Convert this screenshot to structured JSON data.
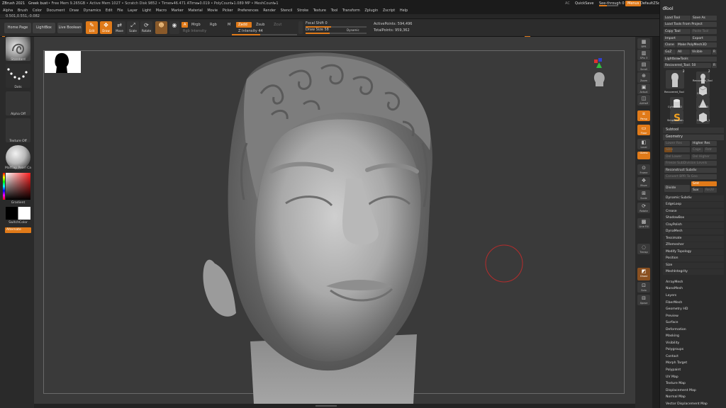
{
  "titlebar": {
    "app": "ZBrush 2021",
    "file": "Greek bust",
    "stats": "• Free Mem 9.265GB • Active Mem 1027 • Scratch Disk 9852 • Timer▸46.471 ATime▸0.019 • PolyCount▸1.089 MP • MeshCount▸1",
    "ai": "AC",
    "quicksave": "QuickSave",
    "see_through": "See-through  0",
    "menus": "Menus",
    "default_script": "DefaultZScript"
  },
  "menu": [
    "Alpha",
    "Brush",
    "Color",
    "Document",
    "Draw",
    "Dynamics",
    "Edit",
    "File",
    "Layer",
    "Light",
    "Macro",
    "Marker",
    "Material",
    "Movie",
    "Picker",
    "Preferences",
    "Render",
    "Stencil",
    "Stroke",
    "Texture",
    "Tool",
    "Transform",
    "Zplugin",
    "Zscript",
    "Help"
  ],
  "coords": "0.501,0.551,-0.082",
  "toolbar": {
    "home_page": "Home Page",
    "lightbox": "LightBox",
    "live_boolean": "Live Boolean",
    "edit": "Edit",
    "draw": "Draw",
    "move": "Move",
    "scale": "Scale",
    "rotate": "Rotate",
    "a_label": "A",
    "mrgb": "Mrgb",
    "rgb": "Rgb",
    "m": "M",
    "zadd": "Zadd",
    "zsub": "Zsub",
    "zcut": "Zcut",
    "rgb_intensity": "Rgb Intensity",
    "z_intensity": "Z Intensity 44",
    "focal_shift": "Focal Shift 0",
    "draw_size": "Draw Size 58",
    "dynamic": "Dynamic",
    "active_points": "ActivePoints: 594,496",
    "total_points": "TotalPoints: 959,362"
  },
  "left_shelf": {
    "brush": "Standard",
    "stroke": "Dots",
    "alpha": "Alpha Off",
    "texture": "Texture Off",
    "material": "MatCap Pearl Ca",
    "gradient": "Gradient",
    "switch_color": "SwitchColor",
    "alternate": "Alternate"
  },
  "right_shelf": [
    {
      "glyph": "▦",
      "label": "BPR"
    },
    {
      "glyph": "▥",
      "label": "SPix 3"
    },
    {
      "glyph": "▤",
      "label": "Scroll"
    },
    {
      "glyph": "⊕",
      "label": "Zoom"
    },
    {
      "glyph": "▣",
      "label": "Actual"
    },
    {
      "glyph": "◫",
      "label": "AAHalf"
    },
    {
      "glyph": "⌗",
      "label": "Persp"
    },
    {
      "glyph": "▭",
      "label": "Floor"
    },
    {
      "glyph": "◧",
      "label": "Local"
    },
    {
      "glyph": "⌖",
      "label": "Gizmo"
    },
    {
      "glyph": "⊙",
      "label": "Frame"
    },
    {
      "glyph": "✥",
      "label": "Move"
    },
    {
      "glyph": "⊞",
      "label": "Scale"
    },
    {
      "glyph": "⟳",
      "label": "Rotate"
    },
    {
      "glyph": "▩",
      "label": "Line Fill"
    },
    {
      "glyph": "◌",
      "label": "Transp"
    },
    {
      "glyph": "◩",
      "label": "Ghost"
    },
    {
      "glyph": "⊡",
      "label": "Solo"
    },
    {
      "glyph": "⊟",
      "label": "Xpose"
    }
  ],
  "tool": {
    "title": "Tool",
    "load_tool": "Load Tool",
    "save_as": "Save As",
    "load_from_project": "Load Tools From Project",
    "copy_tool": "Copy Tool",
    "paste_tool": "Paste Tool",
    "import": "Import",
    "export": "Export",
    "clone": "Clone",
    "make_polymesh": "Make PolyMesh3D",
    "goz": "GoZ",
    "all": "All",
    "visible": "Visible",
    "visible_num": "R",
    "lightbox_tools": "Lightbox▸Tools",
    "recovered": "Recovered_Tool. 50",
    "recovered_num": "R",
    "tiles": [
      {
        "name": "Recovered_Tool",
        "num": "2"
      },
      {
        "name": "Recovered_Tool",
        "num": "2"
      },
      {
        "name": "Cube3D",
        "num": ""
      },
      {
        "name": "Cylinder3D",
        "num": ""
      },
      {
        "name": "Cone3D",
        "num": ""
      },
      {
        "name": "SimpleBrush",
        "num": ""
      },
      {
        "name": "Cube3D_1",
        "num": ""
      }
    ],
    "subtool": "Subtool",
    "geometry": "Geometry",
    "lower_res": "Lower Res",
    "higher_res": "Higher Res",
    "sdiv": "SDiv",
    "cage": "Cage",
    "rstr": "Rstr",
    "del_lower": "Del Lower",
    "del_higher": "Del Higher",
    "freeze_subdiv": "Freeze SubDivision Levels",
    "reconstruct_subdiv": "Reconstruct Subdiv",
    "convert_bpr": "Convert BPR To Geo",
    "divide": "Divide",
    "smt": "Smt",
    "suv": "Suv",
    "reuv": "ReUV",
    "geometry_items": [
      "Dynamic Subdiv",
      "EdgeLoop",
      "Crease",
      "ShadowBox",
      "ClayPolish",
      "DynaMesh",
      "Tessimate",
      "ZRemesher",
      "Modify Topology",
      "Position",
      "Size",
      "MeshIntegrity"
    ],
    "sections": [
      "ArrayMesh",
      "NanoMesh",
      "Layers",
      "FiberMesh",
      "Geometry HD",
      "Preview",
      "Surface",
      "Deformation",
      "Masking",
      "Visibility",
      "Polygroups",
      "Contact",
      "Morph Target",
      "Polypaint",
      "UV Map",
      "Texture Map",
      "Displacement Map",
      "Normal Map",
      "Vector Displacement Map"
    ]
  },
  "colors": {
    "accent": "#e07a19",
    "panel": "#2b2b2b",
    "canvas": "#3a3a3a",
    "brush_cursor": "#b52c2c"
  }
}
